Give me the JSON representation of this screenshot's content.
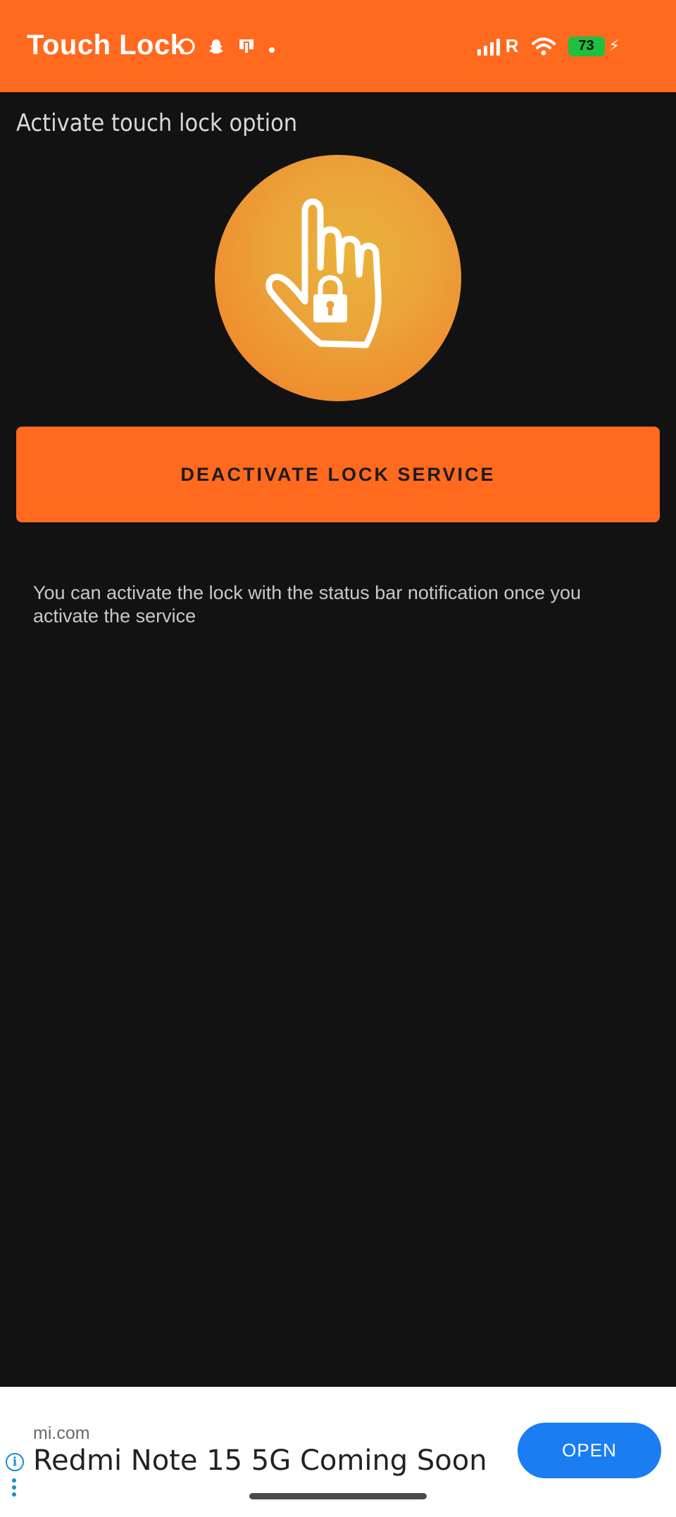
{
  "app": {
    "title": "Touch Lock"
  },
  "status_bar": {
    "network": "R",
    "battery": "73",
    "icons_left": [
      "whatsapp-icon",
      "snapchat-icon",
      "device-icon",
      "dot-icon"
    ]
  },
  "main": {
    "section_title": "Activate touch lock option",
    "logo": "hand-lock-icon",
    "deactivate_button": "DEACTIVATE LOCK SERVICE",
    "info_text": "You can activate the lock with the status bar notification once you activate the service"
  },
  "ad": {
    "domain": "mi.com",
    "headline": "Redmi Note 15 5G Coming Soon",
    "open_label": "OPEN"
  },
  "colors": {
    "accent": "#ff6a1f",
    "background": "#121212",
    "battery": "#1fbf3f",
    "ad_button": "#1a7ef2"
  }
}
